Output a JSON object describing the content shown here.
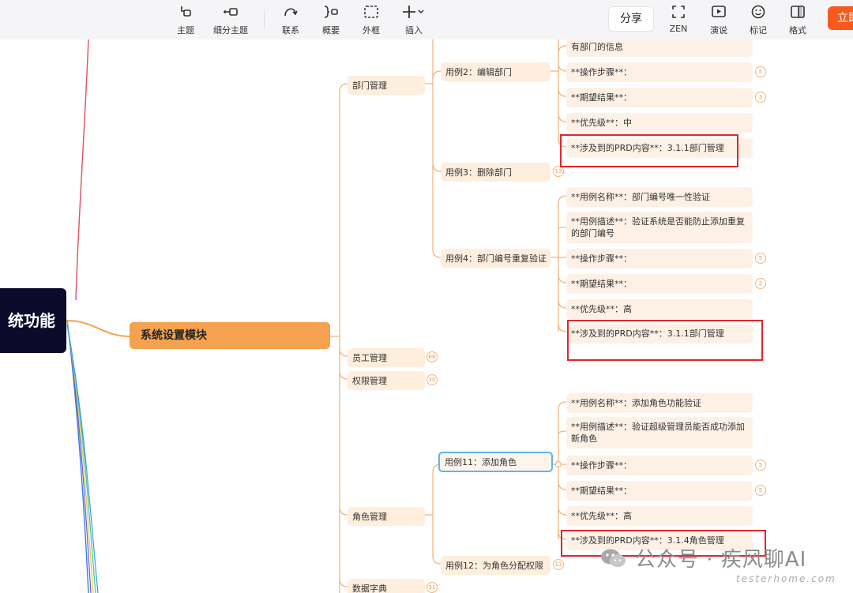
{
  "toolbar": {
    "topic": "主题",
    "subtopic": "细分主题",
    "relation": "联系",
    "summary": "概要",
    "boundary": "外框",
    "insert": "插入",
    "share": "分享",
    "zen": "ZEN",
    "present": "演说",
    "marker": "标记",
    "format": "格式",
    "cta": "立即"
  },
  "map": {
    "root": "统功能",
    "main": "系统设置模块",
    "branches": {
      "dept": "部门管理",
      "staff": "员工管理",
      "perm": "权限管理",
      "role": "角色管理",
      "dict": "数据字典"
    },
    "counts": {
      "staff": "68",
      "perm": "30",
      "dict": "31"
    },
    "dept_cases": {
      "uc2": "用例2：编辑部门",
      "uc3": "用例3：删除部门",
      "uc3_count": "13",
      "uc4": "用例4：部门编号重复验证"
    },
    "uc2_details": {
      "info_tail": "有部门的信息",
      "steps": "**操作步骤**：",
      "steps_count": "5",
      "expected": "**期望结果**：",
      "expected_count": "3",
      "priority": "**优先级**：中",
      "prd": "**涉及到的PRD内容**：3.1.1部门管理"
    },
    "uc4_details": {
      "name": "**用例名称**：部门编号唯一性验证",
      "desc": "**用例描述**：验证系统是否能防止添加重复的部门编号",
      "steps": "**操作步骤**：",
      "steps_count": "5",
      "expected": "**期望结果**：",
      "expected_count": "2",
      "priority": "**优先级**：高",
      "prd": "**涉及到的PRD内容**：3.1.1部门管理"
    },
    "role_cases": {
      "uc11": "用例11：添加角色",
      "uc12": "用例12：为角色分配权限",
      "uc12_count": "13"
    },
    "uc11_details": {
      "name": "**用例名称**：添加角色功能验证",
      "desc": "**用例描述**：验证超级管理员能否成功添加新角色",
      "steps": "**操作步骤**：",
      "steps_count": "5",
      "expected": "**期望结果**：",
      "expected_count": "5",
      "priority": "**优先级**：高",
      "prd": "**涉及到的PRD内容**：3.1.4角色管理"
    }
  },
  "watermark": {
    "text": "公众号 · 疾风聊AI",
    "url": "testerhome.com"
  },
  "colors": {
    "accent": "#f75a1e",
    "root_bg": "#0b0a2b",
    "main_topic": "#f4a24f",
    "connector": "#f0b67e",
    "highlight": "#e0262a",
    "selection": "#5bb8e6"
  }
}
